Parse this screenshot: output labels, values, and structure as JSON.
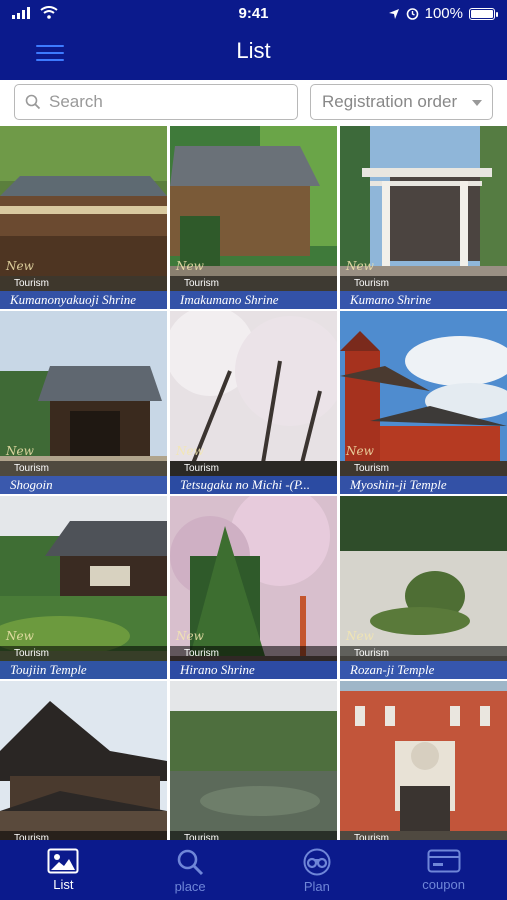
{
  "status_bar": {
    "time": "9:41",
    "battery": "100%"
  },
  "header": {
    "title": "List"
  },
  "search": {
    "placeholder": "Search"
  },
  "sort": {
    "selected": "Registration order"
  },
  "items": [
    {
      "name": "Kumanonyakuoji Shrine",
      "category": "Tourism"
    },
    {
      "name": "Imakumano Shrine",
      "category": "Tourism"
    },
    {
      "name": "Kumano Shrine",
      "category": "Tourism"
    },
    {
      "name": "Shogoin",
      "category": "Tourism"
    },
    {
      "name": "Tetsugaku no Michi -(P...",
      "category": "Tourism"
    },
    {
      "name": "Myoshin-ji Temple",
      "category": "Tourism"
    },
    {
      "name": "Toujiin Temple",
      "category": "Tourism"
    },
    {
      "name": "Hirano Shrine",
      "category": "Tourism"
    },
    {
      "name": "Rozan-ji Temple",
      "category": "Tourism"
    },
    {
      "name": "",
      "category": "Tourism"
    },
    {
      "name": "",
      "category": "Tourism"
    },
    {
      "name": "",
      "category": "Tourism"
    }
  ],
  "tabs": [
    {
      "label": "List",
      "icon": "image-icon",
      "active": true
    },
    {
      "label": "place",
      "icon": "search-icon",
      "active": false
    },
    {
      "label": "Plan",
      "icon": "binoculars-icon",
      "active": false
    },
    {
      "label": "coupon",
      "icon": "coupon-icon",
      "active": false
    }
  ],
  "colors": {
    "nav": "#0b1a8c",
    "name_band": "#2048b4",
    "tab_inactive": "#6f86d8"
  }
}
